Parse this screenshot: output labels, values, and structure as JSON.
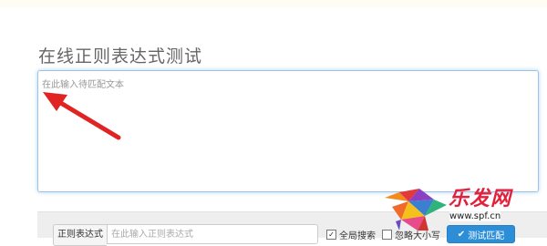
{
  "page": {
    "title": "在线正则表达式测试"
  },
  "editor": {
    "placeholder": "在此输入待匹配文本"
  },
  "regex": {
    "label": "正则表达式",
    "placeholder": "在此输入正则表达式"
  },
  "options": {
    "global_label": "全局搜索",
    "global_checked": true,
    "ignore_case_label": "忽略大小写",
    "ignore_case_checked": false
  },
  "test_button": {
    "label": "测试匹配",
    "icon": "check-icon"
  },
  "watermark": {
    "brand": "乐发网",
    "url": "www.spf.cn"
  },
  "colors": {
    "accent": "#2d8ed8",
    "focus_border": "#9fc3e3",
    "arrow": "#e02424",
    "watermark": "#e3203c"
  }
}
